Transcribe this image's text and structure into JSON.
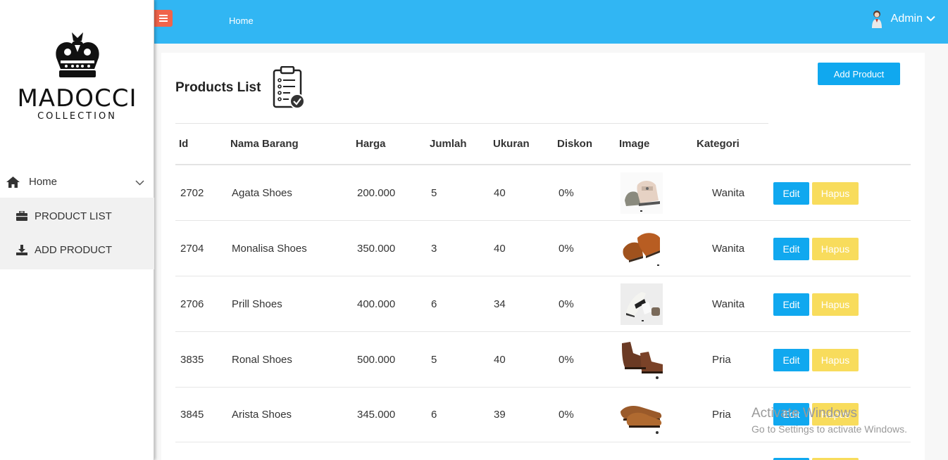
{
  "brand": {
    "name": "MADOCCI",
    "sub": "COLLECTION"
  },
  "sidebar": {
    "home": {
      "label": "Home",
      "icon": "home-icon"
    },
    "items": [
      {
        "label": "PRODUCT LIST",
        "icon": "briefcase-icon"
      },
      {
        "label": "ADD PRODUCT",
        "icon": "download-icon"
      }
    ]
  },
  "topbar": {
    "breadcrumb": "Home",
    "user": "Admin"
  },
  "page": {
    "title": "Products List",
    "add_label": "Add Product"
  },
  "table": {
    "headers": [
      "Id",
      "Nama Barang",
      "Harga",
      "Jumlah",
      "Ukuran",
      "Diskon",
      "Image",
      "Kategori"
    ],
    "edit_label": "Edit",
    "delete_label": "Hapus",
    "rows": [
      {
        "id": "2702",
        "name": "Agata Shoes",
        "price": "200.000",
        "qty": "5",
        "size": "40",
        "disc": "0%",
        "category": "Wanita"
      },
      {
        "id": "2704",
        "name": "Monalisa Shoes",
        "price": "350.000",
        "qty": "3",
        "size": "40",
        "disc": "0%",
        "category": "Wanita"
      },
      {
        "id": "2706",
        "name": "Prill Shoes",
        "price": "400.000",
        "qty": "6",
        "size": "34",
        "disc": "0%",
        "category": "Wanita"
      },
      {
        "id": "3835",
        "name": "Ronal Shoes",
        "price": "500.000",
        "qty": "5",
        "size": "40",
        "disc": "0%",
        "category": "Pria"
      },
      {
        "id": "3845",
        "name": "Arista Shoes",
        "price": "345.000",
        "qty": "6",
        "size": "39",
        "disc": "0%",
        "category": "Pria"
      }
    ]
  },
  "watermark": {
    "line1": "Activate Windows",
    "line2": "Go to Settings to activate Windows."
  },
  "colors": {
    "topbar": "#31b6f3",
    "menu_button": "#f0644b",
    "primary": "#10a8ef",
    "warning": "#f8dc5c"
  }
}
